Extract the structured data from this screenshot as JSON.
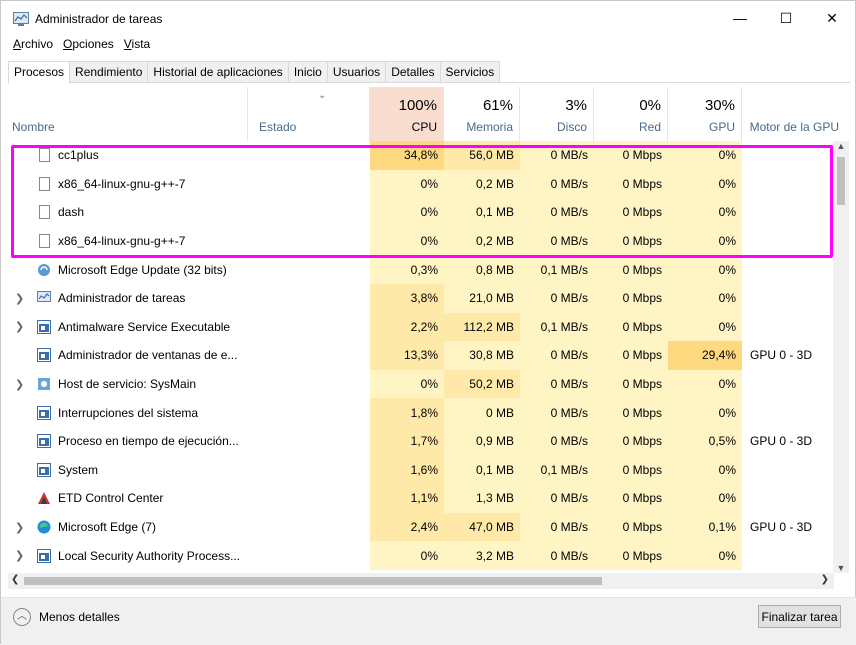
{
  "window": {
    "title": "Administrador de tareas",
    "controls": {
      "minimize": "—",
      "maximize": "☐",
      "close": "✕"
    }
  },
  "menu": [
    "Archivo",
    "Opciones",
    "Vista"
  ],
  "tabs": [
    "Procesos",
    "Rendimiento",
    "Historial de aplicaciones",
    "Inicio",
    "Usuarios",
    "Detalles",
    "Servicios"
  ],
  "columns": {
    "name": "Nombre",
    "status": "Estado",
    "cpu": {
      "pct": "100%",
      "label": "CPU"
    },
    "memory": {
      "pct": "61%",
      "label": "Memoria"
    },
    "disk": {
      "pct": "3%",
      "label": "Disco"
    },
    "network": {
      "pct": "0%",
      "label": "Red"
    },
    "gpu": {
      "pct": "30%",
      "label": "GPU"
    },
    "gpu_engine": "Motor de la GPU"
  },
  "processes": [
    {
      "name": "cc1plus",
      "icon": "document-icon",
      "expandable": false,
      "cpu": "34,8%",
      "mem": "56,0 MB",
      "disk": "0 MB/s",
      "net": "0 Mbps",
      "gpu": "0%",
      "engine": ""
    },
    {
      "name": "x86_64-linux-gnu-g++-7",
      "icon": "document-icon",
      "expandable": false,
      "cpu": "0%",
      "mem": "0,2 MB",
      "disk": "0 MB/s",
      "net": "0 Mbps",
      "gpu": "0%",
      "engine": ""
    },
    {
      "name": "dash",
      "icon": "document-icon",
      "expandable": false,
      "cpu": "0%",
      "mem": "0,1 MB",
      "disk": "0 MB/s",
      "net": "0 Mbps",
      "gpu": "0%",
      "engine": ""
    },
    {
      "name": "x86_64-linux-gnu-g++-7",
      "icon": "document-icon",
      "expandable": false,
      "cpu": "0%",
      "mem": "0,2 MB",
      "disk": "0 MB/s",
      "net": "0 Mbps",
      "gpu": "0%",
      "engine": ""
    },
    {
      "name": "Microsoft Edge Update (32 bits)",
      "icon": "edge-update-icon",
      "expandable": false,
      "cpu": "0,3%",
      "mem": "0,8 MB",
      "disk": "0,1 MB/s",
      "net": "0 Mbps",
      "gpu": "0%",
      "engine": ""
    },
    {
      "name": "Administrador de tareas",
      "icon": "task-manager-icon",
      "expandable": true,
      "cpu": "3,8%",
      "mem": "21,0 MB",
      "disk": "0 MB/s",
      "net": "0 Mbps",
      "gpu": "0%",
      "engine": ""
    },
    {
      "name": "Antimalware Service Executable",
      "icon": "window-icon",
      "expandable": true,
      "cpu": "2,2%",
      "mem": "112,2 MB",
      "disk": "0,1 MB/s",
      "net": "0 Mbps",
      "gpu": "0%",
      "engine": ""
    },
    {
      "name": "Administrador de ventanas de e...",
      "icon": "window-icon",
      "expandable": false,
      "cpu": "13,3%",
      "mem": "30,8 MB",
      "disk": "0 MB/s",
      "net": "0 Mbps",
      "gpu": "29,4%",
      "engine": "GPU 0 - 3D"
    },
    {
      "name": "Host de servicio: SysMain",
      "icon": "gear-icon",
      "expandable": true,
      "cpu": "0%",
      "mem": "50,2 MB",
      "disk": "0 MB/s",
      "net": "0 Mbps",
      "gpu": "0%",
      "engine": ""
    },
    {
      "name": "Interrupciones del sistema",
      "icon": "window-icon",
      "expandable": false,
      "cpu": "1,8%",
      "mem": "0 MB",
      "disk": "0 MB/s",
      "net": "0 Mbps",
      "gpu": "0%",
      "engine": ""
    },
    {
      "name": "Proceso en tiempo de ejecución...",
      "icon": "window-icon",
      "expandable": false,
      "cpu": "1,7%",
      "mem": "0,9 MB",
      "disk": "0 MB/s",
      "net": "0 Mbps",
      "gpu": "0,5%",
      "engine": "GPU 0 - 3D"
    },
    {
      "name": "System",
      "icon": "window-icon",
      "expandable": false,
      "cpu": "1,6%",
      "mem": "0,1 MB",
      "disk": "0,1 MB/s",
      "net": "0 Mbps",
      "gpu": "0%",
      "engine": ""
    },
    {
      "name": "ETD Control Center",
      "icon": "etd-icon",
      "expandable": false,
      "cpu": "1,1%",
      "mem": "1,3 MB",
      "disk": "0 MB/s",
      "net": "0 Mbps",
      "gpu": "0%",
      "engine": ""
    },
    {
      "name": "Microsoft Edge (7)",
      "icon": "edge-icon",
      "expandable": true,
      "cpu": "2,4%",
      "mem": "47,0 MB",
      "disk": "0 MB/s",
      "net": "0 Mbps",
      "gpu": "0,1%",
      "engine": "GPU 0 - 3D"
    },
    {
      "name": "Local Security Authority Process...",
      "icon": "window-icon",
      "expandable": true,
      "cpu": "0%",
      "mem": "3,2 MB",
      "disk": "0 MB/s",
      "net": "0 Mbps",
      "gpu": "0%",
      "engine": ""
    }
  ],
  "footer": {
    "less_details": "Menos detalles",
    "end_task": "Finalizar tarea"
  },
  "colors": {
    "highlight": "#ff00ff",
    "cpu_header": "#f9ded0",
    "heat_low": "#fff4c4",
    "heat_mid": "#ffe9a8",
    "heat_high": "#ffd980"
  }
}
